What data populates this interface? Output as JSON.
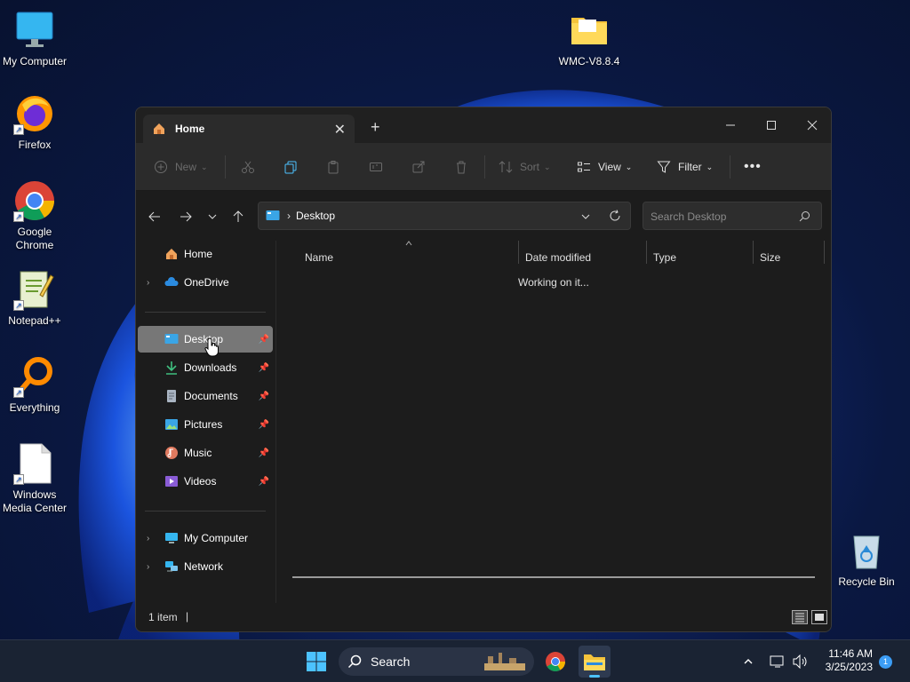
{
  "desktop": {
    "icons": [
      {
        "label": "My Computer",
        "icon": "monitor-icon"
      },
      {
        "label": "Firefox",
        "icon": "firefox-icon"
      },
      {
        "label": "Google Chrome",
        "icon": "chrome-icon"
      },
      {
        "label": "Notepad++",
        "icon": "notepad-plus-plus-icon"
      },
      {
        "label": "Everything",
        "icon": "everything-search-icon"
      },
      {
        "label": "Windows Media Center",
        "icon": "file-icon"
      },
      {
        "label": "WMC-V8.8.4",
        "icon": "folder-icon"
      },
      {
        "label": "Recycle Bin",
        "icon": "recycle-bin-icon"
      }
    ]
  },
  "explorer": {
    "tab_title": "Home",
    "toolbar": {
      "new_label": "New",
      "sort_label": "Sort",
      "view_label": "View",
      "filter_label": "Filter"
    },
    "address": {
      "path": "Desktop"
    },
    "search": {
      "placeholder": "Search Desktop"
    },
    "sidebar": {
      "home": "Home",
      "onedrive": "OneDrive",
      "pinned": [
        "Desktop",
        "Downloads",
        "Documents",
        "Pictures",
        "Music",
        "Videos"
      ],
      "my_computer": "My Computer",
      "network": "Network"
    },
    "columns": {
      "name": "Name",
      "date": "Date modified",
      "type": "Type",
      "size": "Size"
    },
    "status_message": "Working on it...",
    "item_count": "1 item"
  },
  "taskbar": {
    "search_label": "Search",
    "time": "11:46 AM",
    "date": "3/25/2023",
    "notification_count": "1"
  },
  "colors": {
    "accent": "#4cc2ff",
    "window_bg": "#1c1c1c",
    "selected_nav": "#777777"
  }
}
